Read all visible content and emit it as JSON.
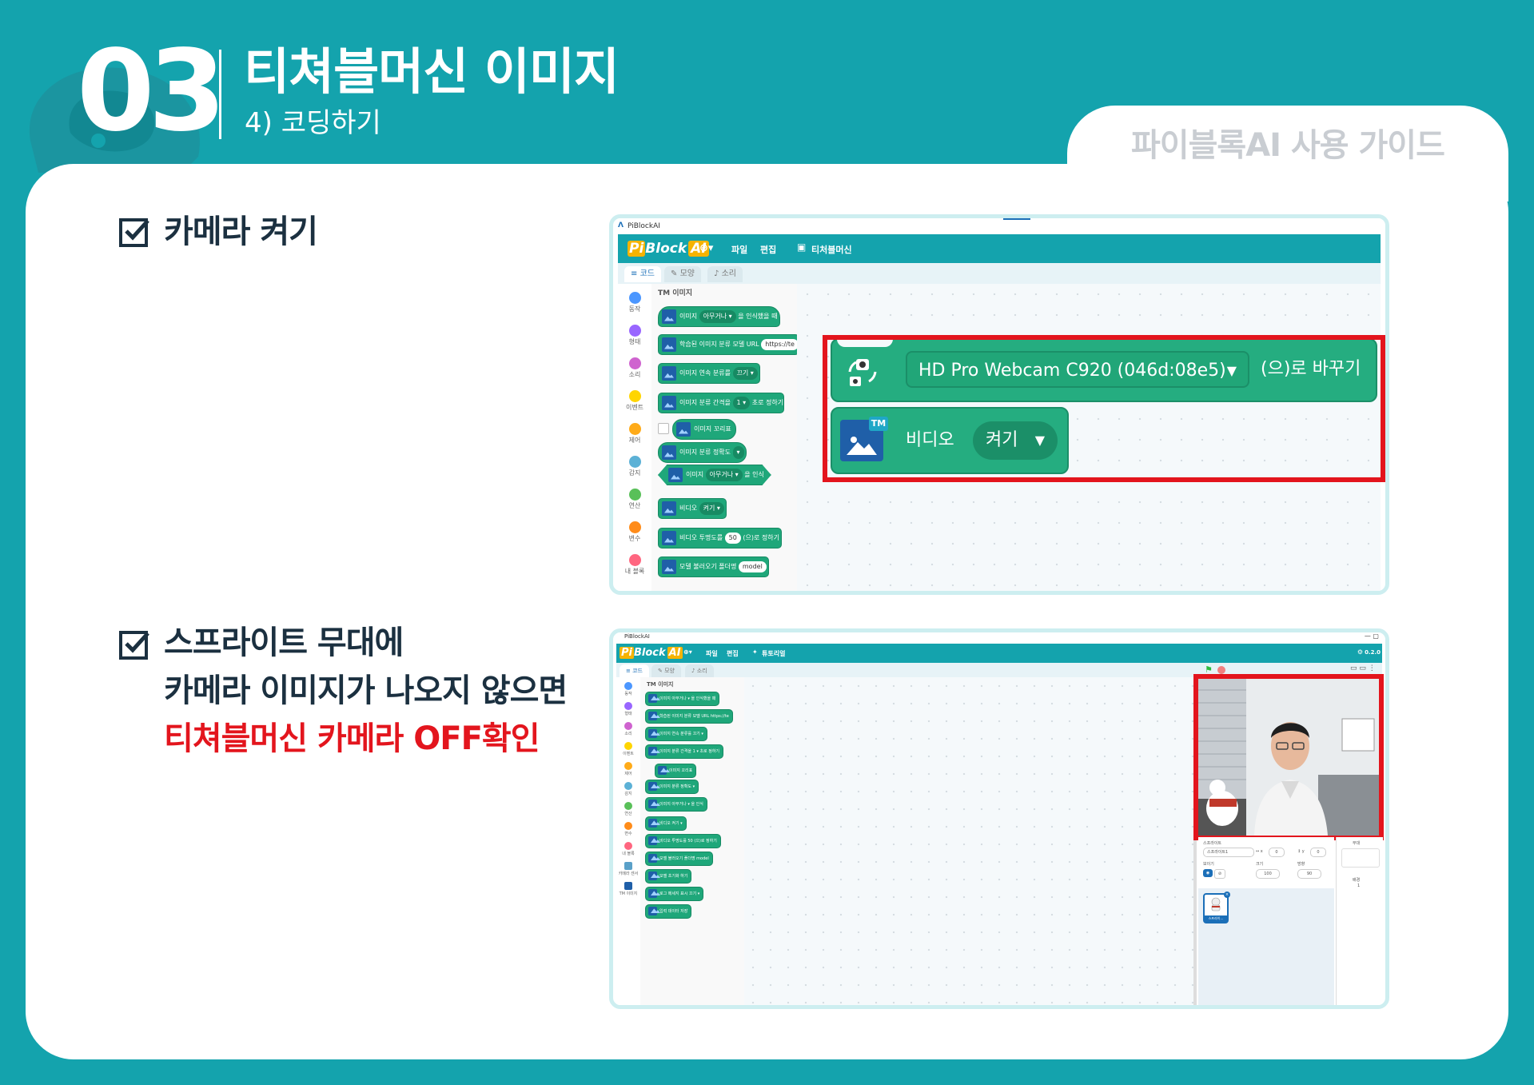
{
  "header": {
    "number": "03",
    "title": "티쳐블머신 이미지",
    "subtitle": "4) 코딩하기",
    "guide": "파이블록AI 사용 가이드"
  },
  "items": [
    {
      "lines": [
        "카메라 켜기"
      ]
    },
    {
      "lines": [
        "스프라이트 무대에",
        "카메라 이미지가 나오지 않으면",
        "티쳐블머신 카메라 OFF확인"
      ]
    }
  ],
  "colors": {
    "teal": "#14a3ad",
    "block_green": "#1fa77a",
    "alert_red": "#e3151d"
  },
  "shot1": {
    "window_title": "PiBlockAI",
    "logo_pi": "Pi",
    "logo_block": "Block",
    "logo_ai": "AI",
    "menu": [
      "파일",
      "편집",
      "티처블머신"
    ],
    "tabs": [
      "코드",
      "모양",
      "소리"
    ],
    "categories": [
      "동작",
      "형태",
      "소리",
      "이벤트",
      "제어",
      "감지",
      "연산",
      "변수",
      "내 블록"
    ],
    "palette_title": "TM 이미지",
    "blocks": [
      {
        "a": "이미지",
        "b": "아무거나 ▾",
        "c": "을 인식했을 때"
      },
      {
        "a": "학습된 이미지 분류 모델 URL",
        "b": "https://te",
        "c": ""
      },
      {
        "a": "이미지 연속 분류를",
        "b": "끄기 ▾",
        "c": ""
      },
      {
        "a": "이미지 분류 간격을",
        "b": "1 ▾",
        "c": "초로 정하기"
      },
      {
        "a": "이미지 꼬리표",
        "b": "",
        "c": ""
      },
      {
        "a": "이미지 분류 정확도",
        "b": "▾",
        "c": ""
      },
      {
        "a": "이미지",
        "b": "아무거나 ▾",
        "c": "을 인식"
      },
      {
        "a": "비디오",
        "b": "켜기 ▾",
        "c": ""
      },
      {
        "a": "비디오 투명도를",
        "b": "50",
        "c": "(으)로 정하기"
      },
      {
        "a": "모델 불러오기 폴더명",
        "b": "model",
        "c": ""
      }
    ],
    "big_block1": {
      "device": "HD Pro Webcam C920 (046d:08e5)",
      "suffix": "(으)로 바꾸기"
    },
    "big_block2": {
      "label": "비디오",
      "value": "켜기"
    }
  },
  "shot2": {
    "window_title": "PiBlockAI",
    "logo_pi": "Pi",
    "logo_block": "Block",
    "logo_ai": "AI",
    "menu": [
      "파일",
      "편집",
      "튜토리얼"
    ],
    "version": "0.2.0",
    "tabs": [
      "코드",
      "모양",
      "소리"
    ],
    "categories": [
      "동작",
      "형태",
      "소리",
      "이벤트",
      "제어",
      "감지",
      "연산",
      "변수",
      "내 블록",
      "카메라 센서",
      "TM 이미지"
    ],
    "palette_title": "TM 이미지",
    "blocks": [
      "이미지 아무거나 ▾ 을 인식했을 때",
      "학습된 이미지 분류 모델 URL https://te",
      "이미지 연속 분류를 끄기 ▾",
      "이미지 분류 간격을 1 ▾ 초로 정하기",
      "이미지 꼬리표",
      "이미지 분류 정확도 ▾",
      "이미지 아무거나 ▾ 을 인식",
      "비디오 켜기 ▾",
      "비디오 투명도를 50 (으)로 정하기",
      "모델 불러오기 폴더명 model",
      "모델 초기화 하기",
      "로그 메세지 표시 끄기 ▾",
      "입력 데이터 저장"
    ],
    "sprite_panel": {
      "label": "스프라이트",
      "name": "스프라이트1",
      "show": "보이기",
      "size_label": "크기",
      "size": "100",
      "dir_label": "방향",
      "dir": "90",
      "x": "0",
      "y": "0",
      "thumb": "스프라이..."
    },
    "stage_panel": {
      "label": "무대",
      "backdrops": "배경",
      "count": "1"
    }
  }
}
